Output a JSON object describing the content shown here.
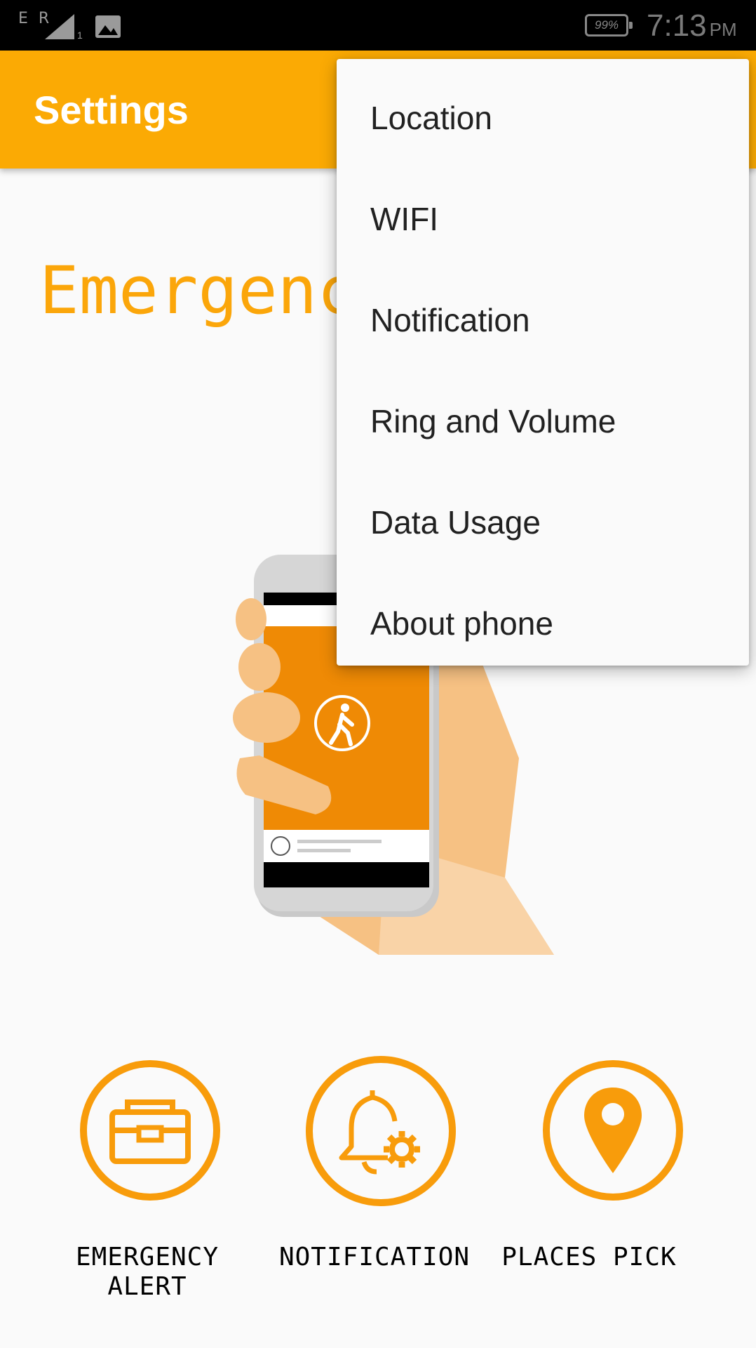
{
  "status_bar": {
    "network_type": "E R",
    "sim_slot": "1",
    "battery": "99%",
    "time": "7:13",
    "ampm": "PM",
    "icons": [
      "data-arrows-icon",
      "signal-icon",
      "gallery-image-icon",
      "battery-icon"
    ]
  },
  "app_bar": {
    "title": "Settings",
    "color": "#fbaa04"
  },
  "main": {
    "headline": "Emergenc",
    "accent_color": "#f89c0b"
  },
  "actions": [
    {
      "label_line1": "EMERGENCY",
      "label_line2": "ALERT",
      "icon": "toolbox-icon"
    },
    {
      "label_line1": "NOTIFICATION",
      "label_line2": "",
      "icon": "bell-gear-icon"
    },
    {
      "label_line1": "PLACES PICK",
      "label_line2": "",
      "icon": "location-pin-icon"
    }
  ],
  "overflow_menu": {
    "items": [
      {
        "label": "Location"
      },
      {
        "label": "WIFI"
      },
      {
        "label": "Notification"
      },
      {
        "label": "Ring and Volume"
      },
      {
        "label": "Data Usage"
      },
      {
        "label": "About phone"
      }
    ]
  }
}
